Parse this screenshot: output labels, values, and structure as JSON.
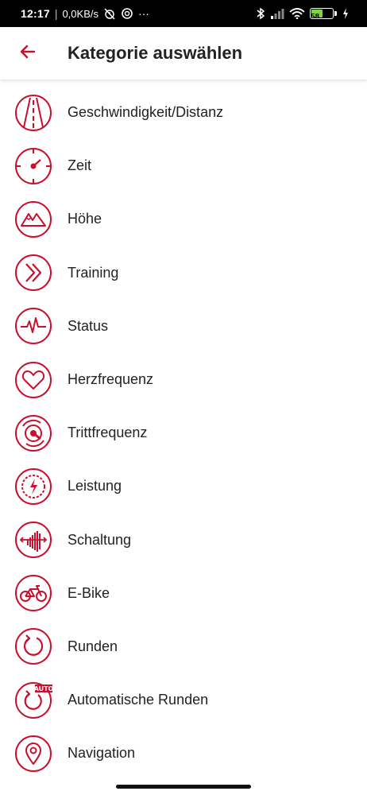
{
  "status_bar": {
    "time": "12:17",
    "separator": "|",
    "network_speed": "0,0KB/s",
    "overflow": "···",
    "battery_level": "58",
    "battery_percent": 58,
    "battery_color": "#7bd93f"
  },
  "header": {
    "title": "Kategorie auswählen",
    "back_icon": "arrow-left-icon"
  },
  "accent_color": "#c8102e",
  "categories": [
    {
      "label": "Geschwindigkeit/Distanz",
      "icon": "road-icon"
    },
    {
      "label": "Zeit",
      "icon": "stopwatch-icon"
    },
    {
      "label": "Höhe",
      "icon": "mountain-icon"
    },
    {
      "label": "Training",
      "icon": "double-chevron-icon"
    },
    {
      "label": "Status",
      "icon": "pulse-icon"
    },
    {
      "label": "Herzfrequenz",
      "icon": "heart-icon"
    },
    {
      "label": "Trittfrequenz",
      "icon": "cadence-icon"
    },
    {
      "label": "Leistung",
      "icon": "power-icon"
    },
    {
      "label": "Schaltung",
      "icon": "gear-shift-icon"
    },
    {
      "label": "E-Bike",
      "icon": "ebike-icon"
    },
    {
      "label": "Runden",
      "icon": "laps-icon"
    },
    {
      "label": "Automatische Runden",
      "icon": "auto-laps-icon",
      "badge": "AUTO"
    },
    {
      "label": "Navigation",
      "icon": "location-pin-icon"
    }
  ]
}
